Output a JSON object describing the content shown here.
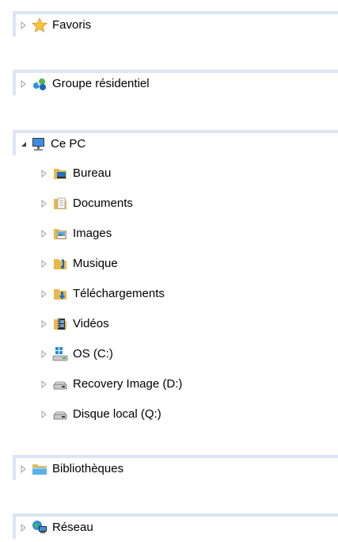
{
  "tree": {
    "favorites": {
      "label": "Favoris",
      "icon": "star-icon"
    },
    "homegroup": {
      "label": "Groupe résidentiel",
      "icon": "homegroup-icon"
    },
    "this_pc": {
      "label": "Ce PC",
      "icon": "computer-icon",
      "expanded": true,
      "children": [
        {
          "label": "Bureau",
          "icon": "desktop-folder-icon"
        },
        {
          "label": "Documents",
          "icon": "documents-folder-icon"
        },
        {
          "label": "Images",
          "icon": "pictures-folder-icon"
        },
        {
          "label": "Musique",
          "icon": "music-folder-icon"
        },
        {
          "label": "Téléchargements",
          "icon": "downloads-folder-icon"
        },
        {
          "label": "Vidéos",
          "icon": "videos-folder-icon"
        },
        {
          "label": "OS (C:)",
          "icon": "system-drive-icon"
        },
        {
          "label": "Recovery Image (D:)",
          "icon": "drive-icon"
        },
        {
          "label": "Disque local (Q:)",
          "icon": "drive-icon"
        }
      ]
    },
    "libraries": {
      "label": "Bibliothèques",
      "icon": "libraries-icon"
    },
    "network": {
      "label": "Réseau",
      "icon": "network-icon"
    }
  },
  "colors": {
    "section_border": "#dbe5f3",
    "arrow": "#a0a0a0",
    "folder_yellow": "#e8b84a",
    "accent_blue": "#1e73c8"
  }
}
